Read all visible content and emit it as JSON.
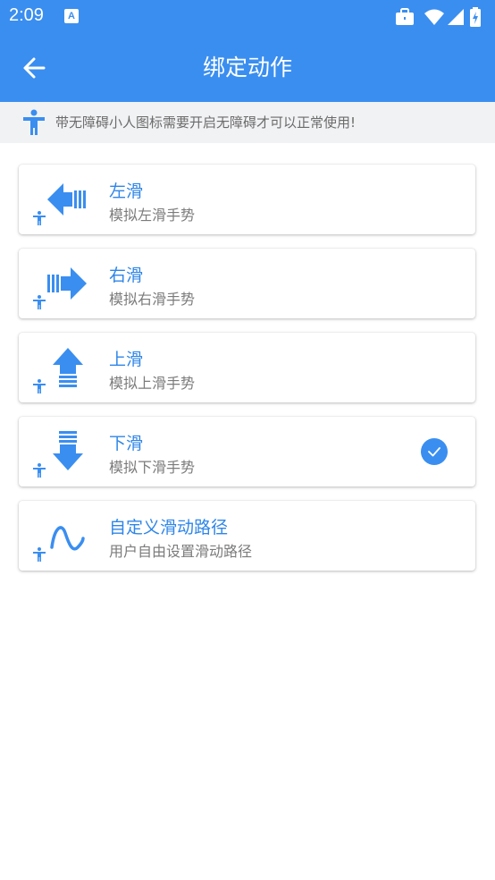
{
  "status_bar": {
    "time": "2:09",
    "notification_glyph": "A"
  },
  "app_bar": {
    "title": "绑定动作",
    "back_icon": "arrow-left-icon"
  },
  "notice": {
    "icon": "accessibility-person-icon",
    "text": "带无障碍小人图标需要开启无障碍才可以正常使用!"
  },
  "colors": {
    "accent": "#3a8ef0",
    "title_text": "#2f86e8",
    "subtitle_text": "#7b7b7b",
    "notice_bg": "#f1f2f4"
  },
  "actions": [
    {
      "title": "左滑",
      "subtitle": "模拟左滑手势",
      "icon": "swipe-left-arrow-icon",
      "selected": false
    },
    {
      "title": "右滑",
      "subtitle": "模拟右滑手势",
      "icon": "swipe-right-arrow-icon",
      "selected": false
    },
    {
      "title": "上滑",
      "subtitle": "模拟上滑手势",
      "icon": "swipe-up-arrow-icon",
      "selected": false
    },
    {
      "title": "下滑",
      "subtitle": "模拟下滑手势",
      "icon": "swipe-down-arrow-icon",
      "selected": true
    },
    {
      "title": "自定义滑动路径",
      "subtitle": "用户自由设置滑动路径",
      "icon": "custom-path-wave-icon",
      "selected": false
    }
  ]
}
